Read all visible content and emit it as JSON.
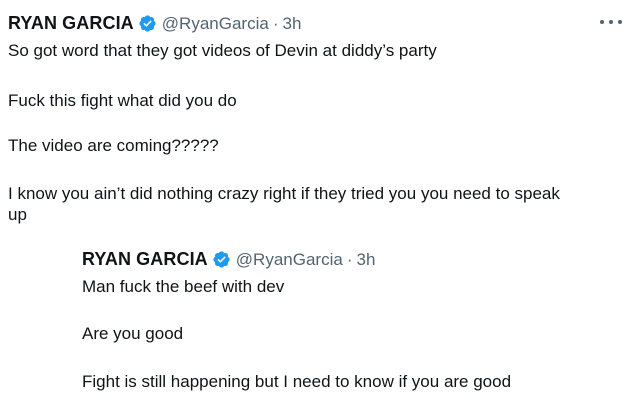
{
  "tweet": {
    "author": {
      "name": "RYAN GARCIA",
      "handle": "@RyanGarcia",
      "time": "3h",
      "separator": "·"
    },
    "body": [
      "So got word that they got videos of Devin at diddy’s party",
      "Fuck this fight what did you do",
      "The video are coming?????",
      "I know you ain’t did nothing crazy right if they tried you you need to speak",
      "up"
    ],
    "more_icon": "more-horizontal-icon",
    "verified_icon": "verified-badge-icon",
    "accent_color": "#1d9bf0"
  },
  "quoted_reply": {
    "author": {
      "name": "RYAN GARCIA",
      "handle": "@RyanGarcia",
      "time": "3h",
      "separator": "·"
    },
    "body": [
      "Man fuck the beef with dev",
      "Are you good",
      "Fight is still happening but I need to know if you are good"
    ]
  }
}
